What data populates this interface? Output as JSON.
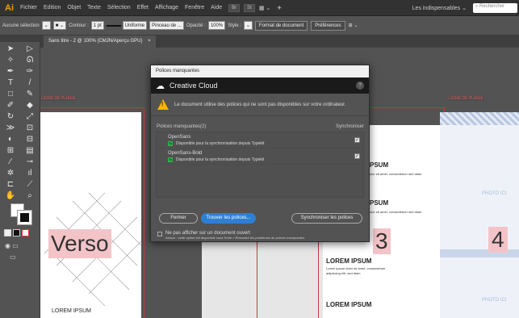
{
  "menubar": {
    "logo": "Ai",
    "menus": [
      "Fichier",
      "Edition",
      "Objet",
      "Texte",
      "Sélection",
      "Effet",
      "Affichage",
      "Fenêtre",
      "Aide"
    ],
    "app_buttons": [
      "Br",
      "St"
    ],
    "workspace": "Les indispensables ⌄",
    "search_placeholder": "Rechercher"
  },
  "controlbar": {
    "selection": "Aucune sélection",
    "contour_label": "Contour :",
    "contour_value": "1 pt",
    "profile": "Uniforme",
    "brush": "Pinceau de ...",
    "opacity_label": "Opacité :",
    "opacity_value": "100%",
    "style_label": "Style :",
    "format_button": "Format de document",
    "prefs_button": "Préférences"
  },
  "document_tab": {
    "title": "Sans titre - 2 @ 100% (CMJN/Aperçu GPU)",
    "close": "×"
  },
  "canvas": {
    "fold_left": "LIGNE DE PLIAGE",
    "fold_right": "LIGNE DE PLIAGE",
    "verso": "Verso",
    "page3": "3",
    "page4": "4",
    "photo1": "PHOTO ICI",
    "photo2": "PHOTO ICI",
    "lorem_heading": "LOREM IPSUM",
    "lorem_short": "PSUM",
    "lorem_body": "Lorem ipsum dolor sit amet, consectetuer adipiscing elit, sed diam",
    "lorem_partial": "olor sit amet, consectetuer sed diam"
  },
  "dialog": {
    "title": "Polices manquantes",
    "cc_name": "Creative Cloud",
    "help": "?",
    "warning": "Le document utilise des polices qui ne sont pas disponibles sur votre ordinateur.",
    "list_header": "Polices manquantes(2)",
    "sync_header": "Synchroniser",
    "fonts": [
      {
        "name": "OpenSans",
        "status": "Disponible pour la synchronisation depuis Typekit",
        "checked": "✓"
      },
      {
        "name": "OpenSans-Bold",
        "status": "Disponible pour la synchronisation depuis Typekit",
        "checked": "✓"
      }
    ],
    "btn_close": "Fermer",
    "btn_find": "Trouver les polices...",
    "btn_sync": "Synchroniser les polices",
    "footer_check": "Ne pas afficher sur un document ouvert",
    "footer_hint": "Astuce : cette option est disponible sous Texte > Résoudre les problèmes de polices manquantes.",
    "colors": {
      "primary": "#2d7fd3",
      "warning": "#f5b400",
      "typekit": "#2bb24c"
    }
  }
}
